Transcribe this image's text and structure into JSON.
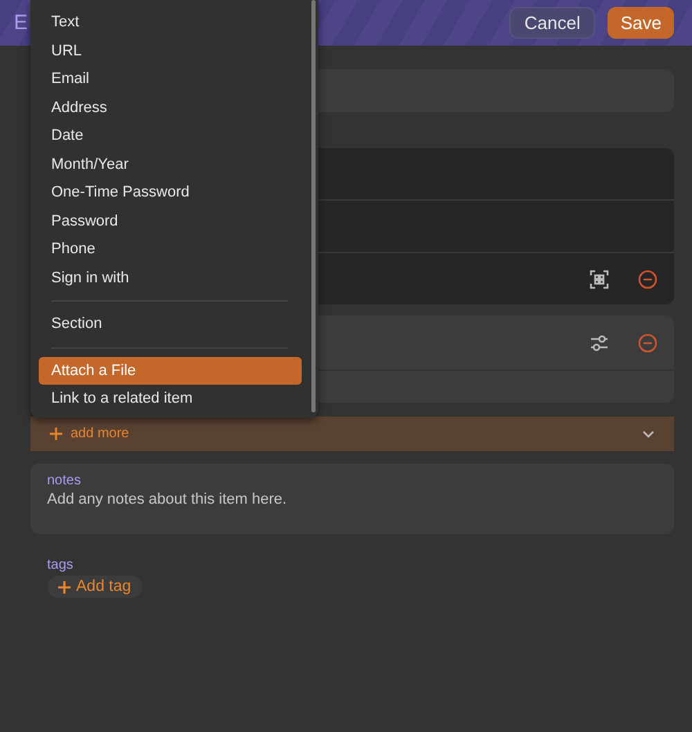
{
  "header": {
    "title": "E",
    "cancel": "Cancel",
    "save": "Save"
  },
  "menu": [
    {
      "kind": "item",
      "label": "Text",
      "selected": false
    },
    {
      "kind": "item",
      "label": "URL",
      "selected": false
    },
    {
      "kind": "item",
      "label": "Email",
      "selected": false
    },
    {
      "kind": "item",
      "label": "Address",
      "selected": false
    },
    {
      "kind": "item",
      "label": "Date",
      "selected": false
    },
    {
      "kind": "item",
      "label": "Month/Year",
      "selected": false
    },
    {
      "kind": "item",
      "label": "One-Time Password",
      "selected": false
    },
    {
      "kind": "item",
      "label": "Password",
      "selected": false
    },
    {
      "kind": "item",
      "label": "Phone",
      "selected": false
    },
    {
      "kind": "item",
      "label": "Sign in with",
      "selected": false
    },
    {
      "kind": "separator"
    },
    {
      "kind": "item",
      "label": "Section",
      "selected": false
    },
    {
      "kind": "separator"
    },
    {
      "kind": "item",
      "label": "Attach a File",
      "selected": true
    },
    {
      "kind": "item",
      "label": "Link to a related item",
      "selected": false
    }
  ],
  "sections": [
    {
      "kind": "dark",
      "rows": [
        {
          "kind": "plain"
        },
        {
          "kind": "plain"
        },
        {
          "kind": "scan"
        }
      ]
    },
    {
      "kind": "light",
      "rows": [
        {
          "kind": "settings"
        },
        {
          "kind": "footer"
        }
      ]
    }
  ],
  "add_more": {
    "label": "add more"
  },
  "notes": {
    "label": "notes",
    "placeholder": "Add any notes about this item here."
  },
  "tags": {
    "label": "tags",
    "button": "Add tag"
  }
}
